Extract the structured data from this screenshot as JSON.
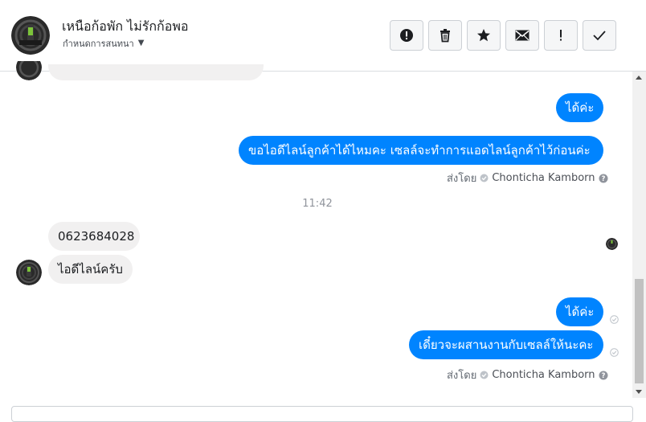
{
  "header": {
    "title": "เหนือก้อพัก ไม่รักก้อพอ",
    "subtitle": "กำหนดการสนทนา",
    "tools": [
      {
        "name": "report-spam-button",
        "icon": "alert-circle-icon"
      },
      {
        "name": "delete-button",
        "icon": "trash-icon"
      },
      {
        "name": "star-button",
        "icon": "star-icon"
      },
      {
        "name": "mark-unread-button",
        "icon": "envelope-icon"
      },
      {
        "name": "important-button",
        "icon": "exclamation-icon"
      },
      {
        "name": "mark-done-button",
        "icon": "check-icon"
      }
    ]
  },
  "messages": {
    "out_1": "ได้ค่ะ",
    "out_2": "ขอไอดีไลน์ลูกค้าได้ไหมคะ เซลล์จะทำการแอดไลน์ลูกค้าไว้ก่อนค่ะ",
    "time_separator": "11:42",
    "in_1": "0623684028",
    "in_2": "ไอดีไลน์ครับ",
    "out_3": "ได้ค่ะ",
    "out_4": "เดี๋ยวจะผสานงานกับเซลล์ให้นะคะ"
  },
  "sent_by": {
    "prefix": "ส่งโดย",
    "name": "Chonticha Kamborn"
  },
  "colors": {
    "outgoing_bubble": "#0084ff",
    "incoming_bubble": "#f1f0f0"
  }
}
